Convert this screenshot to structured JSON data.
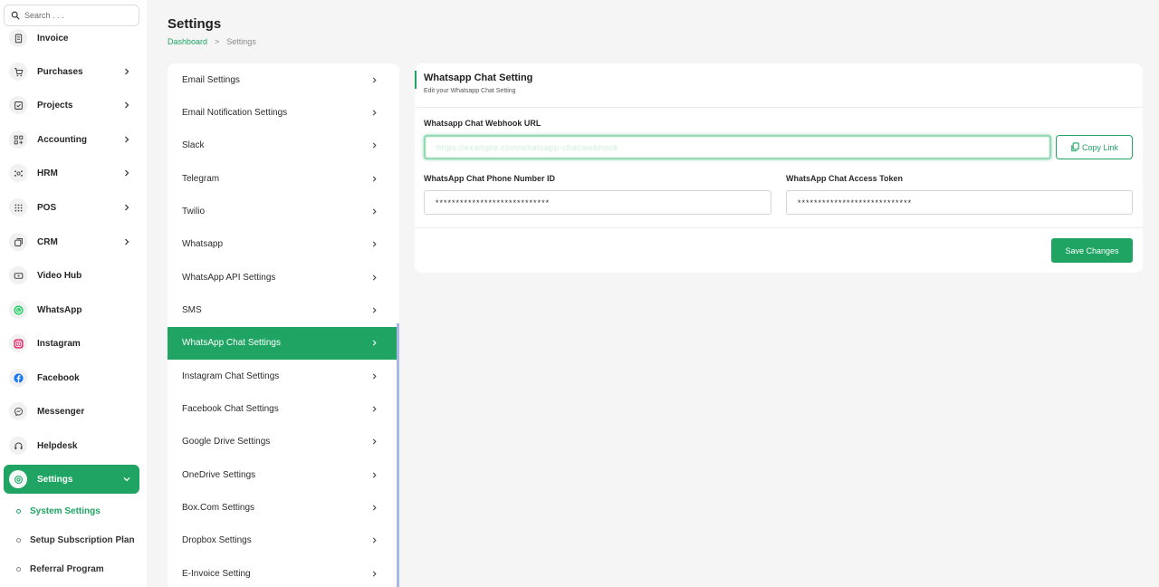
{
  "search": {
    "placeholder": "Search . . ."
  },
  "sidebar": {
    "items": [
      {
        "label": "Invoice",
        "icon": "invoice-icon",
        "has_chevron": false
      },
      {
        "label": "Purchases",
        "icon": "cart-icon",
        "has_chevron": true
      },
      {
        "label": "Projects",
        "icon": "check-square-icon",
        "has_chevron": true
      },
      {
        "label": "Accounting",
        "icon": "grid-plus-icon",
        "has_chevron": true
      },
      {
        "label": "HRM",
        "icon": "users-icon",
        "has_chevron": true
      },
      {
        "label": "POS",
        "icon": "dots-grid-icon",
        "has_chevron": true
      },
      {
        "label": "CRM",
        "icon": "layers-icon",
        "has_chevron": true
      },
      {
        "label": "Video Hub",
        "icon": "video-icon",
        "has_chevron": false
      },
      {
        "label": "WhatsApp",
        "icon": "whatsapp-icon",
        "has_chevron": false
      },
      {
        "label": "Instagram",
        "icon": "instagram-icon",
        "has_chevron": false
      },
      {
        "label": "Facebook",
        "icon": "facebook-icon",
        "has_chevron": false
      },
      {
        "label": "Messenger",
        "icon": "messenger-icon",
        "has_chevron": false
      },
      {
        "label": "Helpdesk",
        "icon": "headset-icon",
        "has_chevron": false
      },
      {
        "label": "Settings",
        "icon": "gear-icon",
        "has_chevron": true
      }
    ],
    "sub_items": [
      {
        "label": "System Settings",
        "current": true
      },
      {
        "label": "Setup Subscription Plan",
        "current": false
      },
      {
        "label": "Referral Program",
        "current": false
      }
    ]
  },
  "header": {
    "title": "Settings",
    "breadcrumb": {
      "link": "Dashboard",
      "separator": ">",
      "current": "Settings"
    }
  },
  "settings_menu": {
    "active_index": 8,
    "items": [
      "Email Settings",
      "Email Notification Settings",
      "Slack",
      "Telegram",
      "Twilio",
      "Whatsapp",
      "WhatsApp API Settings",
      "SMS",
      "WhatsApp Chat Settings",
      "Instagram Chat Settings",
      "Facebook Chat Settings",
      "Google Drive Settings",
      "OneDrive Settings",
      "Box.Com Settings",
      "Dropbox Settings",
      "E-Invoice Setting"
    ]
  },
  "card": {
    "title": "Whatsapp Chat Setting",
    "subtitle": "Edit your Whatsapp Chat Setting",
    "webhook_label": "Whatsapp Chat Webhook URL",
    "webhook_value": "https://example.com/whatsapp-chat/webhook",
    "copy_label": "Copy Link",
    "phone_label": "WhatsApp Chat Phone Number ID",
    "phone_value": "****************************",
    "token_label": "WhatsApp Chat Access Token",
    "token_value": "****************************",
    "save_label": "Save Changes"
  },
  "colors": {
    "accent": "#1fa463",
    "background": "#f4f5f4"
  }
}
